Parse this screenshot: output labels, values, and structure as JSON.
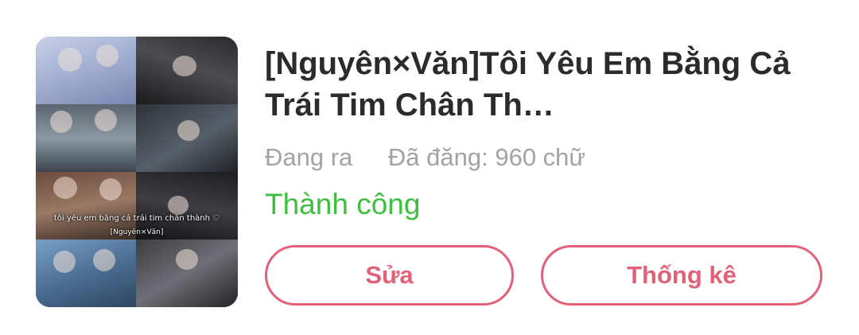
{
  "story": {
    "title": "[Nguyên×Văn]Tôi Yêu Em Bằng Cả Trái Tim Chân Th…",
    "cover": {
      "caption": "tôi yêu em bằng cả trái tim chân thành ♡",
      "sub_caption": "[Nguyên×Văn]"
    },
    "status_label": "Đang ra",
    "posted_label": "Đã đăng: 960 chữ",
    "result_label": "Thành công"
  },
  "actions": {
    "edit_label": "Sửa",
    "stats_label": "Thống kê"
  },
  "colors": {
    "accent": "#e2607a",
    "success": "#3fbf3f",
    "title": "#2b2b2b",
    "meta": "#a3a3a3"
  }
}
